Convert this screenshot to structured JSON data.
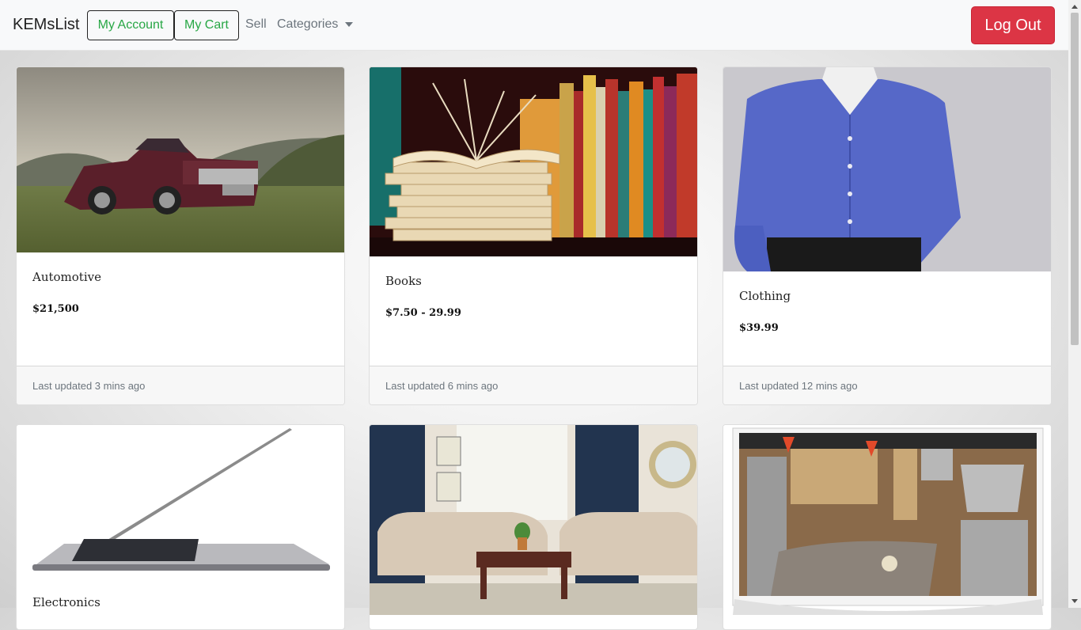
{
  "navbar": {
    "brand": "KEMsList",
    "my_account": "My Account",
    "my_cart": "My Cart",
    "sell": "Sell",
    "categories": "Categories",
    "log_out": "Log Out"
  },
  "colors": {
    "accent_green": "#28a745",
    "danger_red": "#dc3545"
  },
  "cards": [
    {
      "title": "Automotive",
      "price": "$21,500",
      "updated": "Last updated 3 mins ago",
      "image": "pickup-truck-photo"
    },
    {
      "title": "Books",
      "price": "$7.50 - 29.99",
      "updated": "Last updated 6 mins ago",
      "image": "books-stack-photo"
    },
    {
      "title": "Clothing",
      "price": "$39.99",
      "updated": "Last updated 12 mins ago",
      "image": "blue-shirt-photo"
    },
    {
      "title": "Electronics",
      "image": "laptop-photo"
    },
    {
      "image": "living-room-photo"
    },
    {
      "image": "kitchen-photo"
    }
  ]
}
